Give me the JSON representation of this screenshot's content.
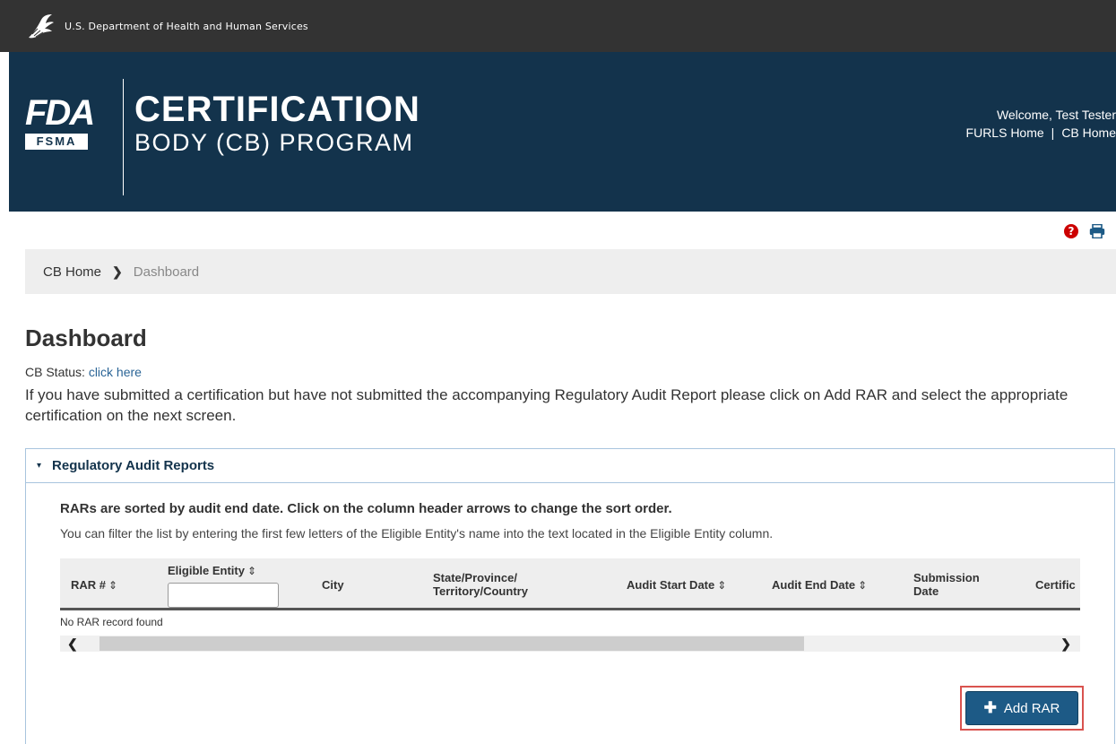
{
  "hhs_bar": {
    "agency": "U.S. Department of Health and Human Services",
    "icon": "hhs-eagle-icon"
  },
  "banner": {
    "logo_letters": "FDA",
    "logo_sub": "FSMA",
    "title_line1": "CERTIFICATION",
    "title_line2": "BODY (CB) PROGRAM",
    "welcome": "Welcome, Test Tester",
    "link_furls_home": "FURLS Home",
    "link_separator": "|",
    "link_cb_home": "CB Home"
  },
  "utilities": {
    "help_icon": "question-circle-icon",
    "print_icon": "printer-icon",
    "help_glyph": "?"
  },
  "breadcrumb": {
    "home": "CB Home",
    "separator": "❯",
    "current": "Dashboard"
  },
  "page": {
    "title": "Dashboard",
    "status_label": "CB Status: ",
    "status_link": "click here",
    "intro": "If you have submitted a certification but have not submitted the accompanying Regulatory Audit Report please click on Add RAR and select the appropriate certification on the next screen."
  },
  "panel": {
    "caret": "▾",
    "title": "Regulatory Audit Reports",
    "sort_note": "RARs are sorted by audit end date. Click on the column header arrows to change the sort order.",
    "filter_note": "You can filter the list by entering the first few letters of the Eligible Entity's name into the text located in the Eligible Entity column.",
    "table": {
      "columns": [
        {
          "label": "RAR #",
          "sortable": true
        },
        {
          "label": "Eligible Entity",
          "sortable": true,
          "filter": true
        },
        {
          "label": "City",
          "sortable": false
        },
        {
          "label": "State/Province/\nTerritory/Country",
          "sortable": false
        },
        {
          "label": "Audit Start Date",
          "sortable": true
        },
        {
          "label": "Audit End Date",
          "sortable": true
        },
        {
          "label": "Submission\nDate",
          "sortable": false
        },
        {
          "label": "Certific",
          "sortable": false
        }
      ],
      "sort_glyph": "⇕",
      "empty_message": "No RAR record found",
      "filter_value": "",
      "scroll_left": "❮",
      "scroll_right": "❯"
    },
    "add_button": {
      "icon": "plus-icon",
      "plus_glyph": "✚",
      "label": "Add RAR"
    }
  },
  "colors": {
    "banner_bg": "#13334c",
    "hhs_bar_bg": "#333333",
    "button_bg": "#1d5a86",
    "highlight_border": "#d9534f",
    "link": "#2a6496"
  }
}
